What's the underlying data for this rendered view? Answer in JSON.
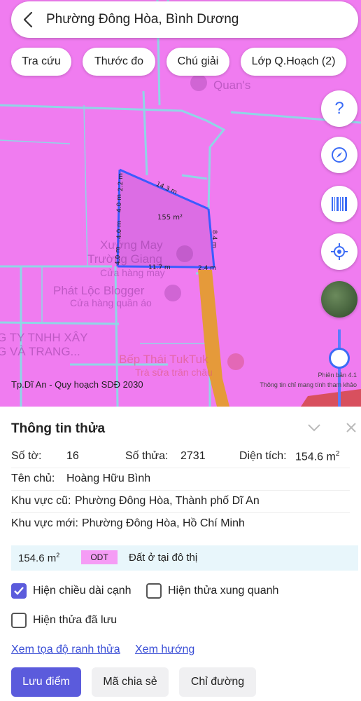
{
  "header": {
    "title": "Phường Đông Hòa, Bình Dương"
  },
  "chips": [
    "Tra cứu",
    "Thước đo",
    "Chú giải",
    "Lớp Q.Hoạch (2)"
  ],
  "fabs": {
    "help": "?"
  },
  "map": {
    "labels": {
      "quans": "Quan's",
      "xuong_may_1": "Xưởng May",
      "xuong_may_2": "Trường Giang",
      "xuong_may_3": "Cửa hàng may",
      "phat_loc_1": "Phát Lộc Blogger",
      "phat_loc_2": "Cửa hàng quần áo",
      "cty_1": "G TY TNHH XÂY",
      "cty_2": "G VÀ TRANG...",
      "bep_thai_1": "Bếp Thái TukTuk",
      "bep_thai_2": "Trà sữa trân châu"
    },
    "parcel": {
      "area": "155 m²",
      "edges": [
        "14.3 m",
        "8.4 m",
        "2.4 m",
        "11.7 m",
        "4.0 m",
        "4.0 m",
        "4.0 m",
        "2.2 m"
      ]
    },
    "source": "Tp.Dĩ An - Quy hoạch SDĐ 2030",
    "version_line1": "Phiên bản 4.1",
    "version_line2": "Thông tin chỉ mang tính tham khảo",
    "colors": {
      "residential": "#f07cf0",
      "road": "#e59a3a",
      "edge": "#3b5bff"
    }
  },
  "panel": {
    "title": "Thông tin thửa",
    "so_to_label": "Số tờ:",
    "so_to_value": "16",
    "so_thua_label": "Số thửa:",
    "so_thua_value": "2731",
    "dien_tich_label": "Diện tích:",
    "dien_tich_value": "154.6 m",
    "dien_tich_unit_sup": "2",
    "ten_chu_label": "Tên chủ:",
    "ten_chu_value": "Hoàng Hữu Bình",
    "khu_vuc_cu_label": "Khu vực cũ:",
    "khu_vuc_cu_value": "Phường Đông Hòa, Thành phố Dĩ An",
    "khu_vuc_moi_label": "Khu vực mới:",
    "khu_vuc_moi_value": "Phường Đông Hòa, Hồ Chí Minh",
    "land_area": "154.6 m",
    "land_area_sup": "2",
    "land_code": "ODT",
    "land_type": "Đất ở tại đô thị",
    "land_code_color": "#f59cf5",
    "checkboxes": [
      {
        "label": "Hiện chiều dài cạnh",
        "checked": true
      },
      {
        "label": "Hiện thửa xung quanh",
        "checked": false
      },
      {
        "label": "Hiện thửa đã lưu",
        "checked": false
      }
    ],
    "links": [
      "Xem tọa độ ranh thửa",
      "Xem hướng"
    ],
    "buttons": [
      "Lưu điểm",
      "Mã chia sẻ",
      "Chỉ đường"
    ]
  }
}
